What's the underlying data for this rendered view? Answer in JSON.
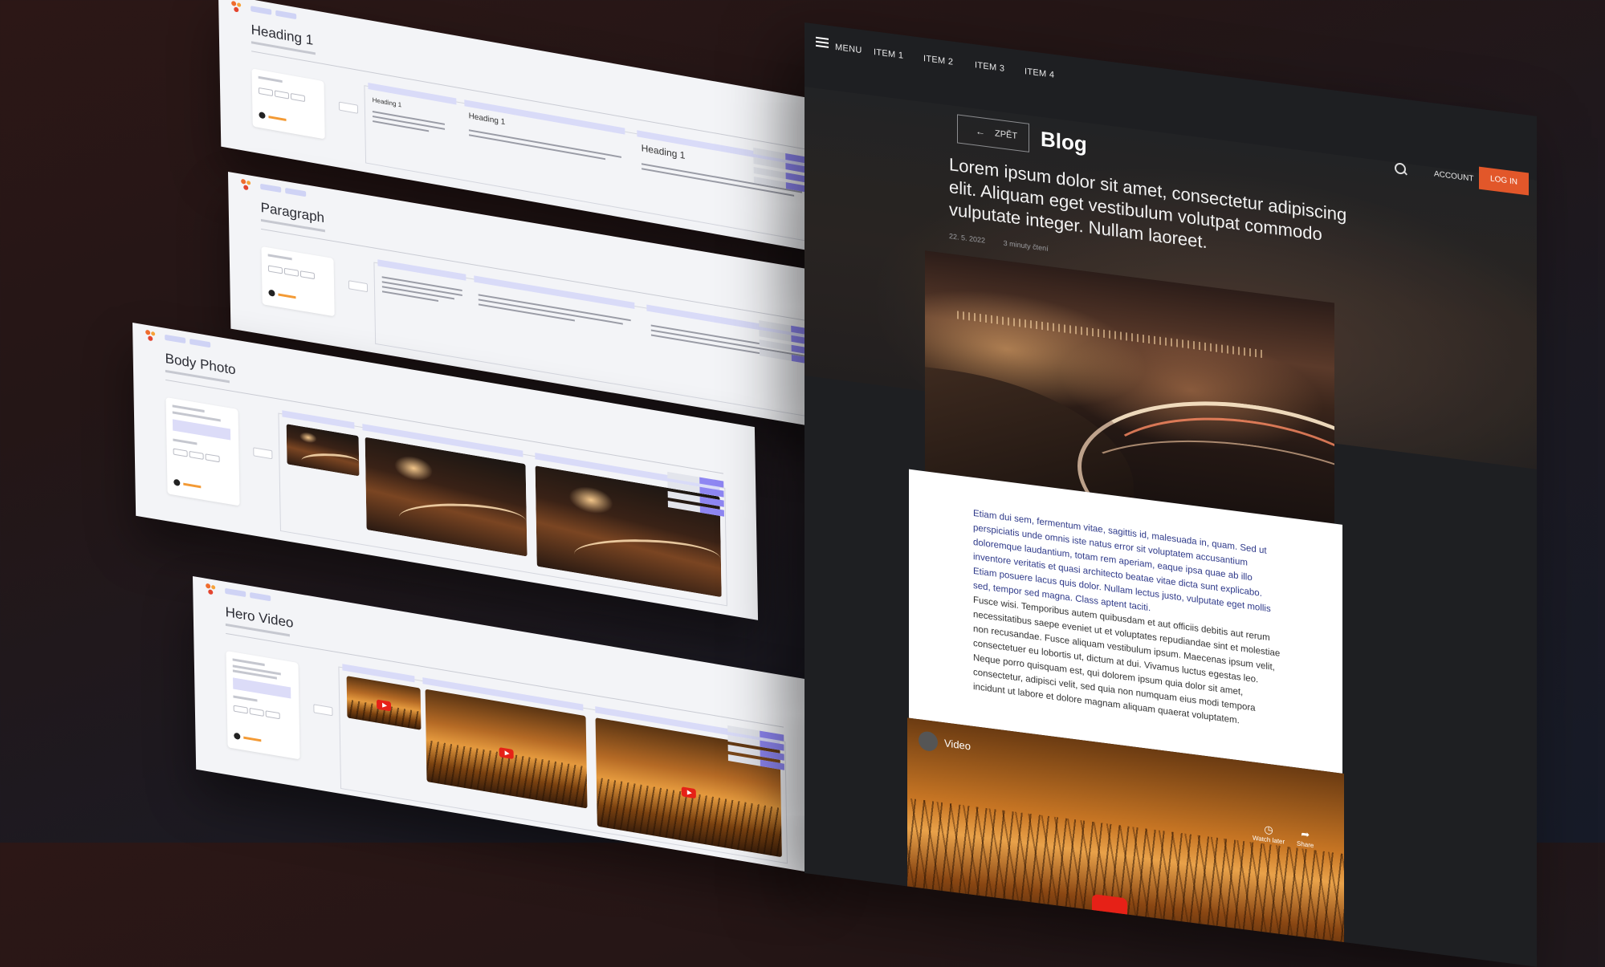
{
  "cards": [
    {
      "title": "Heading 1",
      "pane_headings": [
        "Heading 1",
        "Heading 1",
        "Heading 1"
      ]
    },
    {
      "title": "Paragraph"
    },
    {
      "title": "Body Photo"
    },
    {
      "title": "Hero Video"
    }
  ],
  "blog": {
    "nav": {
      "menu_label": "MENU",
      "items": [
        "ITEM 1",
        "ITEM 2",
        "ITEM 3",
        "ITEM 4"
      ],
      "account_label": "ACCOUNT",
      "login_label": "LOG IN"
    },
    "back_label": "ZPĚT",
    "page_title": "Blog",
    "headline": "Lorem ipsum dolor sit amet, consectetur adipiscing elit. Aliquam eget vestibulum volutpat commodo vulputate integer. Nullam laoreet.",
    "meta": {
      "date": "22. 5. 2022",
      "read_time": "3 minuty čtení"
    },
    "paragraphs": [
      "Etiam dui sem, fermentum vitae, sagittis id, malesuada in, quam. Sed ut perspiciatis unde omnis iste natus error sit voluptatem accusantium doloremque laudantium, totam rem aperiam, eaque ipsa quae ab illo inventore veritatis et quasi architecto beatae vitae dicta sunt explicabo. Etiam posuere lacus quis dolor. Nullam lectus justo, vulputate eget mollis sed, tempor sed magna. Class aptent taciti.",
      "Fusce wisi. Temporibus autem quibusdam et aut officiis debitis aut rerum necessitatibus saepe eveniet ut et voluptates repudiandae sint et molestiae non recusandae. Fusce aliquam vestibulum ipsum. Maecenas ipsum velit, consectetuer eu lobortis ut, dictum at dui. Vivamus luctus egestas leo. Neque porro quisquam est, qui dolorem ipsum quia dolor sit amet, consectetur, adipisci velit, sed quia non numquam eius modi tempora incidunt ut labore et dolore magnam aliquam quaerat voluptatem."
    ],
    "video": {
      "title": "Video",
      "watch_later_label": "Watch later",
      "share_label": "Share"
    }
  }
}
